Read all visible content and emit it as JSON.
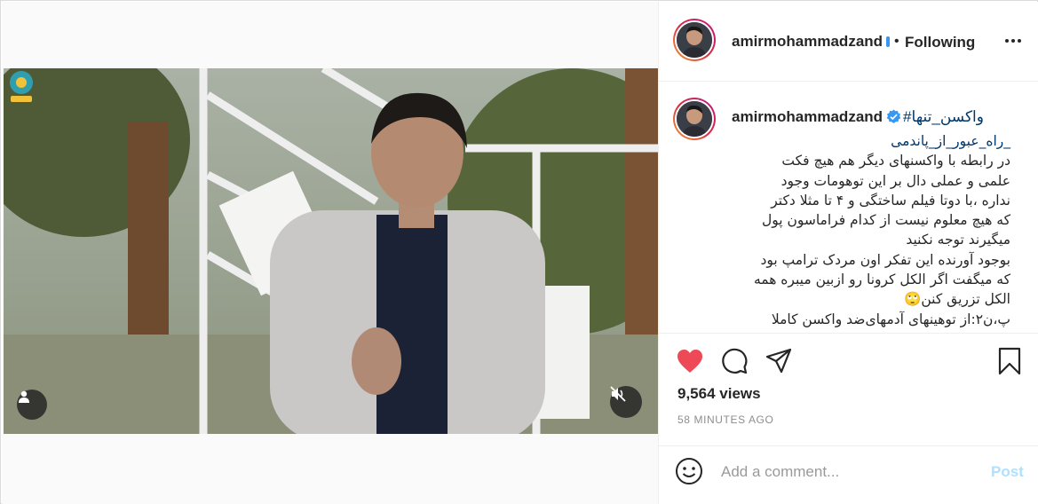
{
  "post": {
    "username": "amirmohammadzand",
    "separator": "•",
    "follow_status": "Following",
    "caption": {
      "hashtag_1": "#واکسن_تنها",
      "hashtag_2": "_راه_عبور_از_پاندمی",
      "lines": [
        "در رابطه با واکسنهای دیگر هم هیچ فکت",
        "علمی و عملی دال بر این توهومات وجود",
        "نداره ،با دوتا فیلم ساختگی و ۴ تا مثلا دکتر",
        "که هیچ معلوم نیست از کدام فراماسون پول",
        "میگیرند توجه نکنید",
        "بوجود آورنده این تفکر اون مردک ترامپ بود",
        "که میگفت اگر الکل کرونا رو ازبین میبره همه",
        "الکل تزریق کنن🙄",
        "پ،ن۲:از توهینهای آدمهای‌ضد واکسن کاملا"
      ]
    },
    "views": "9,564 views",
    "time_ago": "58 MINUTES AGO",
    "comment_placeholder": "Add a comment...",
    "post_label": "Post"
  },
  "icons": {
    "like": "heart-icon",
    "comment": "comment-icon",
    "share": "paper-plane-icon",
    "save": "bookmark-icon",
    "more": "more-options-icon",
    "emoji": "emoji-icon",
    "mute": "muted-speaker-icon",
    "user_tags": "user-icon",
    "verified": "verified-badge-icon"
  },
  "colors": {
    "like": "#ed4956",
    "link": "#00376b",
    "verified": "#3897f0",
    "post_disabled": "#b2dffc",
    "muted_text": "#8e8e8e"
  }
}
